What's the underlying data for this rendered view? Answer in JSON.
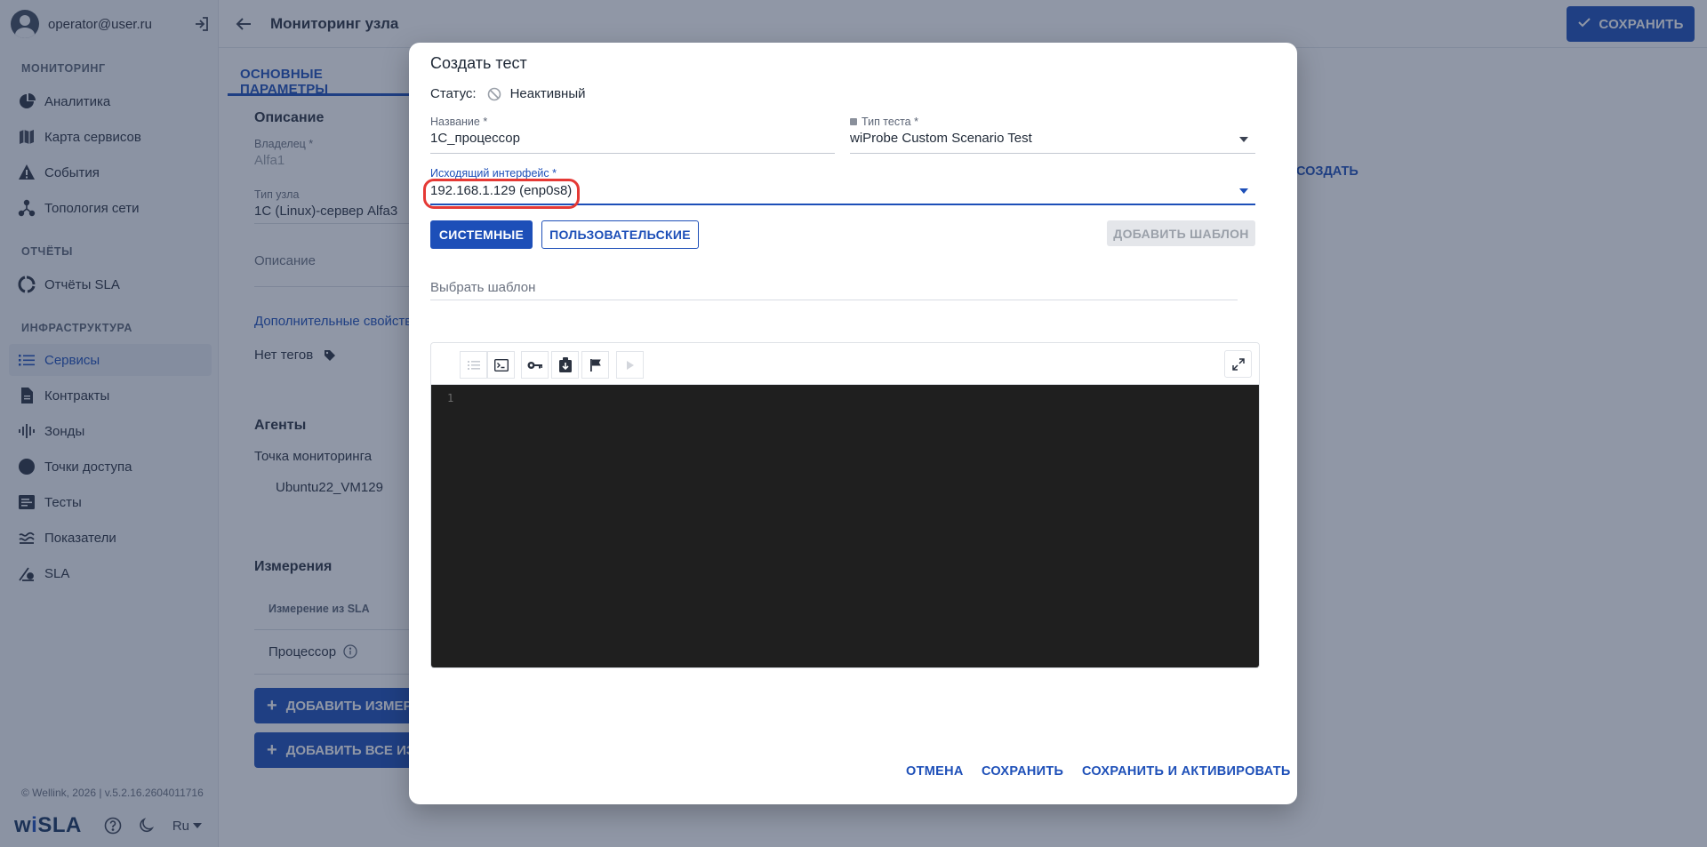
{
  "sidebar": {
    "user_email": "operator@user.ru",
    "sections": {
      "monitoring": "МОНИТОРИНГ",
      "reports": "ОТЧЁТЫ",
      "infrastructure": "ИНФРАСТРУКТУРА"
    },
    "items": [
      {
        "label": "Аналитика",
        "icon": "pie-chart-icon"
      },
      {
        "label": "Карта сервисов",
        "icon": "map-icon"
      },
      {
        "label": "События",
        "icon": "warning-icon"
      },
      {
        "label": "Топология сети",
        "icon": "topology-icon"
      },
      {
        "label": "Отчёты SLA",
        "icon": "report-ring-icon"
      },
      {
        "label": "Сервисы",
        "icon": "list-icon",
        "active": true
      },
      {
        "label": "Контракты",
        "icon": "document-icon"
      },
      {
        "label": "Зонды",
        "icon": "probe-icon"
      },
      {
        "label": "Точки доступа",
        "icon": "access-point-icon"
      },
      {
        "label": "Тесты",
        "icon": "tests-icon"
      },
      {
        "label": "Показатели",
        "icon": "metrics-icon"
      },
      {
        "label": "SLA",
        "icon": "sla-icon"
      }
    ],
    "footer_text": "© Wellink, 2026 | v.5.2.16.2604011716",
    "logo": {
      "prefix": "w",
      "i": "i",
      "suffix": "SLA"
    },
    "language": "Ru"
  },
  "topbar": {
    "title": "Мониторинг узла",
    "save_label": "СОХРАНИТЬ"
  },
  "page": {
    "tab_main": "ОСНОВНЫЕ ПАРАМЕТРЫ",
    "description_head": "Описание",
    "owner_label": "Владелец *",
    "owner_value": "Alfa1",
    "node_type_label": "Тип узла",
    "node_type_value": "1C (Linux)-сервер Alfa3",
    "description_field": "Описание",
    "extra_props": "Дополнительные свойства",
    "no_tags": "Нет тегов",
    "agents_head": "Агенты",
    "monitoring_point": "Точка мониторинга",
    "agent_value": "Ubuntu22_VM129",
    "measurements_head": "Измерения",
    "measure_col": "Измерение из SLA",
    "measure_row": "Процессор",
    "add_measure_btn": "ДОБАВИТЬ ИЗМЕРЕНИЕ",
    "add_all_btn": "ДОБАВИТЬ ВСЕ ИЗМЕРЕНИЯ",
    "create_link": "СОЗДАТЬ"
  },
  "modal": {
    "title": "Создать тест",
    "status_label": "Статус:",
    "status_value": "Неактивный",
    "name_label": "Название *",
    "name_value": "1С_процессор",
    "test_type_label": "Тип теста *",
    "test_type_value": "wiProbe Custom Scenario Test",
    "iface_label": "Исходящий интерфейс *",
    "iface_value": "192.168.1.129 (enp0s8)",
    "btn_system": "СИСТЕМНЫЕ",
    "btn_user": "ПОЛЬЗОВАТЕЛЬСКИЕ",
    "btn_add_template": "ДОБАВИТЬ ШАБЛОН",
    "template_placeholder": "Выбрать шаблон",
    "editor": {
      "line_numbers": [
        "1"
      ],
      "toolbar": [
        "list-icon",
        "terminal-icon",
        "key-icon",
        "download-box-icon",
        "flag-icon",
        "play-icon"
      ]
    },
    "btn_cancel": "ОТМЕНА",
    "btn_save": "СОХРАНИТЬ",
    "btn_save_activate": "СОХРАНИТЬ И АКТИВИРОВАТЬ"
  },
  "colors": {
    "accent": "#1d4fb8",
    "highlight": "#e53935",
    "editor_bg": "#1f1f1f"
  }
}
